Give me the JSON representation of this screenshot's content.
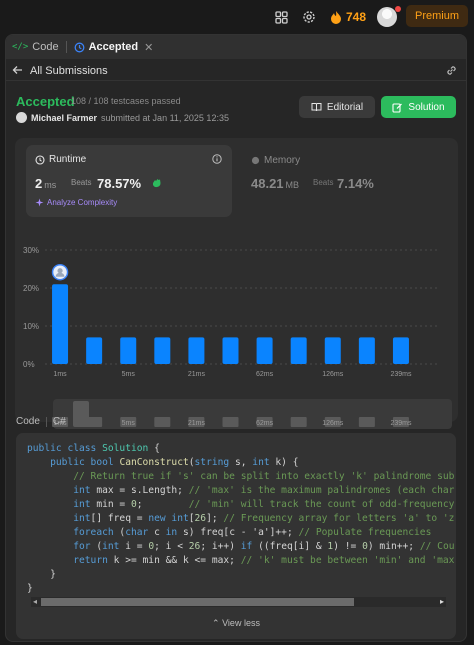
{
  "topnav": {
    "streak": "748",
    "premium": "Premium",
    "colors": {
      "accent": "#ffa116",
      "notify": "#ef4743"
    }
  },
  "tabs": [
    {
      "label": "Code",
      "icon": "code-icon"
    },
    {
      "label": "Accepted",
      "icon": "history-icon",
      "active": true
    }
  ],
  "subheader": {
    "back": "All Submissions"
  },
  "result": {
    "status": "Accepted",
    "testcases": "108 / 108 testcases passed",
    "author": "Michael Farmer",
    "submitted": "submitted at Jan 11, 2025 12:35",
    "editorial": "Editorial",
    "solution": "Solution",
    "colors": {
      "accepted": "#2cbb5d"
    }
  },
  "runtime": {
    "label": "Runtime",
    "value": "2",
    "unit": "ms",
    "beats_label": "Beats",
    "beats": "78.57%",
    "analyze": "Analyze Complexity"
  },
  "memory": {
    "label": "Memory",
    "value": "48.21",
    "unit": "MB",
    "beats_label": "Beats",
    "beats": "7.14%"
  },
  "chart_data": {
    "type": "bar",
    "categories": [
      "1ms",
      "",
      "5ms",
      "",
      "21ms",
      "",
      "62ms",
      "",
      "126ms",
      "",
      "239ms"
    ],
    "values": [
      21,
      7,
      7,
      7,
      7,
      7,
      7,
      7,
      7,
      7,
      7
    ],
    "yticks": [
      "0%",
      "10%",
      "20%",
      "30%"
    ],
    "ylim": [
      0,
      30
    ],
    "highlight_index": 0,
    "color": "#0a84ff",
    "grid": true
  },
  "code_header": {
    "label": "Code",
    "language": "C#"
  },
  "code_lines": [
    "public class Solution {",
    "    public bool CanConstruct(string s, int k) {",
    "        // Return true if 's' can be split into exactly 'k' palindrome sub",
    "        int max = s.Length; // 'max' is the maximum palindromes (each char",
    "        int min = 0;        // 'min' will track the count of odd-frequency",
    "        int[] freq = new int[26]; // Frequency array for letters 'a' to 'z",
    "        foreach (char c in s) freq[c - 'a']++; // Populate frequencies",
    "        for (int i = 0; i < 26; i++) if ((freq[i] & 1) != 0) min++; // Cou",
    "        return k >= min && k <= max; // 'k' must be between 'min' and 'max",
    "    }",
    "}"
  ],
  "view_less": "View less"
}
